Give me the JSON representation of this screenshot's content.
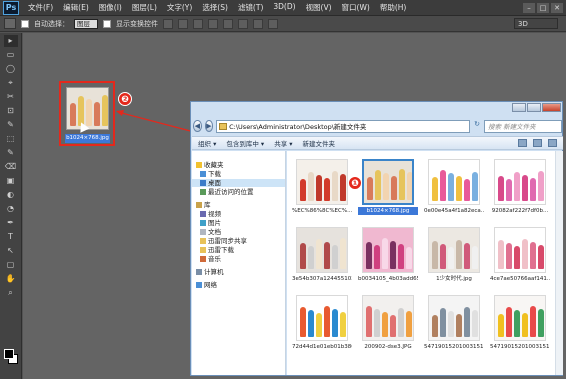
{
  "ps": {
    "menu": [
      "文件(F)",
      "编辑(E)",
      "图像(I)",
      "图层(L)",
      "文字(Y)",
      "选择(S)",
      "滤镜(T)",
      "3D(D)",
      "视图(V)",
      "窗口(W)",
      "帮助(H)"
    ],
    "options": {
      "auto_select": "自动选择：",
      "auto_select_value": "图层",
      "show_transform": "显示变换控件",
      "mode3d": "3D"
    },
    "tools": [
      "▸",
      "▭",
      "◯",
      "⌖",
      "✂",
      "⊡",
      "✎",
      "⬚",
      "✎",
      "⌫",
      "▣",
      "◐",
      "◔",
      "✒",
      "T",
      "↖",
      "▢",
      "✋",
      "⌕"
    ]
  },
  "drag": {
    "file_label": "b1024×768.jpg"
  },
  "badges": {
    "one": "❶",
    "two": "❷"
  },
  "explorer": {
    "path": "C:\\Users\\Administrator\\Desktop\\新建文件夹",
    "search_placeholder": "搜索 新建文件夹",
    "cmdbar": [
      "组织 ▾",
      "包含到库中 ▾",
      "共享 ▾",
      "新建文件夹"
    ],
    "sidebar": [
      {
        "label": "收藏夹",
        "group": true,
        "icon": "star-icon"
      },
      {
        "label": "下载",
        "group": false,
        "icon": "download-icon"
      },
      {
        "label": "桌面",
        "group": false,
        "icon": "desktop-icon",
        "selected": true
      },
      {
        "label": "最近访问的位置",
        "group": false,
        "icon": "recent-icon"
      },
      {
        "label": "库",
        "group": true,
        "icon": "library-icon"
      },
      {
        "label": "视频",
        "group": false,
        "icon": "video-icon"
      },
      {
        "label": "图片",
        "group": false,
        "icon": "picture-icon"
      },
      {
        "label": "文档",
        "group": false,
        "icon": "document-icon"
      },
      {
        "label": "迅雷同步共享",
        "group": false,
        "icon": "folder-icon"
      },
      {
        "label": "迅雷下载",
        "group": false,
        "icon": "folder-icon"
      },
      {
        "label": "音乐",
        "group": false,
        "icon": "music-icon"
      },
      {
        "label": "计算机",
        "group": true,
        "icon": "computer-icon"
      },
      {
        "label": "网络",
        "group": true,
        "icon": "network-icon"
      }
    ],
    "files": [
      {
        "name": "%EC%86%8C%EC%...",
        "selected": false
      },
      {
        "name": "b1024×768.jpg",
        "selected": true
      },
      {
        "name": "0e00e45a4f1a82eca...",
        "selected": false
      },
      {
        "name": "92082af222f7df0b...",
        "selected": false
      },
      {
        "name": "3e54b307a124455103...",
        "selected": false
      },
      {
        "name": "b0034105_4b03add65...",
        "selected": false
      },
      {
        "name": "1少女时代.jpg",
        "selected": false
      },
      {
        "name": "4ce7ae50766aaf141...",
        "selected": false
      },
      {
        "name": "72d44d1e01eb01b386...",
        "selected": false
      },
      {
        "name": "200902-dse3.JPG",
        "selected": false
      },
      {
        "name": "54719015201003151 8...",
        "selected": false
      },
      {
        "name": "54719015201003151 8...",
        "selected": false
      }
    ]
  },
  "colors": {
    "accent_red": "#e4281c",
    "selection_blue": "#3c78d8"
  }
}
